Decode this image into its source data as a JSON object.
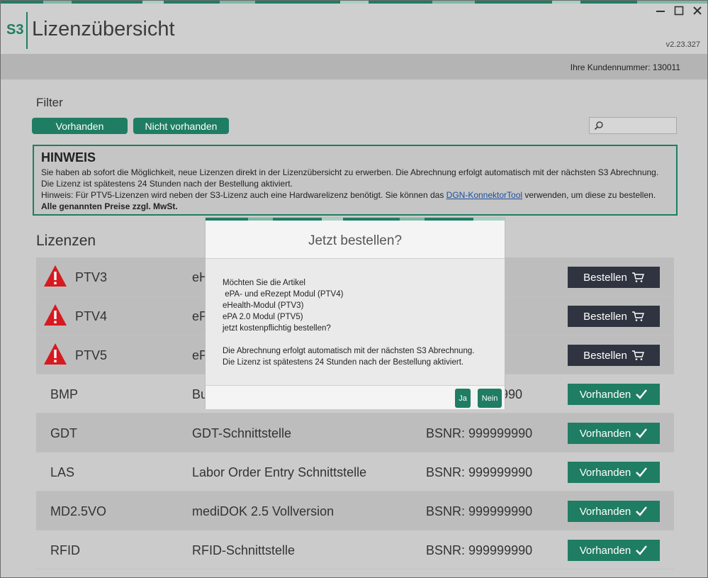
{
  "app": {
    "logo": "S3",
    "title": "Lizenzübersicht",
    "version": "v2.23.327",
    "customer_label": "Ihre Kundennummer: 130011"
  },
  "colors": {
    "accent": "#1f7d63",
    "dark_button": "#2f3440",
    "warning": "#d71920",
    "link": "#1b4fa0"
  },
  "filter": {
    "label": "Filter",
    "btn_available": "Vorhanden",
    "btn_not_available": "Nicht vorhanden",
    "search_placeholder": ""
  },
  "hint": {
    "title": "HINWEIS",
    "line1": "Sie haben ab sofort die Möglichkeit, neue Lizenzen direkt in der Lizenzübersicht zu erwerben. Die Abrechnung erfolgt automatisch mit der nächsten S3 Abrechnung.",
    "line2": "Die Lizenz ist spätestens 24 Stunden nach der Bestellung aktiviert.",
    "line3_pre": "Hinweis: Für PTV5-Lizenzen wird neben der S3-Lizenz auch eine Hardwarelizenz benötigt. Sie können das ",
    "line3_link": "DGN-KonnektorTool",
    "line3_post": " verwenden, um diese zu bestellen.",
    "line4": "Alle genannten Preise zzgl. MwSt."
  },
  "licenses": {
    "title": "Lizenzen",
    "rows": [
      {
        "code": "PTV3",
        "desc": "eH",
        "bsnr": "",
        "action": "Bestellen",
        "warning": true
      },
      {
        "code": "PTV4",
        "desc": "eP",
        "bsnr": "",
        "action": "Bestellen",
        "warning": true
      },
      {
        "code": "PTV5",
        "desc": "eP",
        "bsnr": "",
        "action": "Bestellen",
        "warning": true
      },
      {
        "code": "BMP",
        "desc": "Bu",
        "bsnr": "990",
        "action": "Vorhanden",
        "warning": false
      },
      {
        "code": "GDT",
        "desc": "GDT-Schnittstelle",
        "bsnr": "BSNR: 999999990",
        "action": "Vorhanden",
        "warning": false
      },
      {
        "code": "LAS",
        "desc": "Labor Order Entry Schnittstelle",
        "bsnr": "BSNR: 999999990",
        "action": "Vorhanden",
        "warning": false
      },
      {
        "code": "MD2.5VO",
        "desc": "mediDOK 2.5 Vollversion",
        "bsnr": "BSNR: 999999990",
        "action": "Vorhanden",
        "warning": false
      },
      {
        "code": "RFID",
        "desc": "RFID-Schnittstelle",
        "bsnr": "BSNR: 999999990",
        "action": "Vorhanden",
        "warning": false
      }
    ]
  },
  "modal": {
    "title": "Jetzt bestellen?",
    "lines": [
      "Möchten Sie die Artikel",
      " ePA- und eRezept Modul (PTV4)",
      "eHealth-Modul (PTV3)",
      "ePA 2.0 Modul (PTV5)",
      "jetzt kostenpflichtig bestellen?",
      "",
      "Die Abrechnung erfolgt automatisch mit der nächsten S3 Abrechnung.",
      "Die Lizenz ist spätestens 24 Stunden nach der Bestellung aktiviert."
    ],
    "btn_yes": "Ja",
    "btn_no": "Nein"
  }
}
